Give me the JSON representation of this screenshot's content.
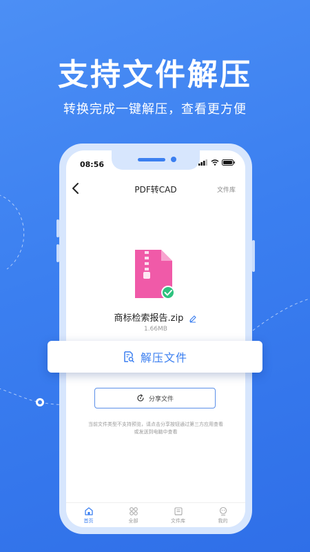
{
  "promo": {
    "headline": "支持文件解压",
    "subline": "转换完成一键解压，查看更方便"
  },
  "status_bar": {
    "time": "08:56"
  },
  "navbar": {
    "title": "PDF转CAD",
    "right_link": "文件库"
  },
  "file": {
    "name": "商标检索报告.zip",
    "size": "1.66MB"
  },
  "actions": {
    "unzip_label": "解压文件",
    "share_label": "分享文件"
  },
  "note": "当前文件类型不支持预览，请点击分享按钮通过第三方应用查看或发送到电脑中查看",
  "tabbar": [
    {
      "label": "首页",
      "icon": "home-icon",
      "active": true
    },
    {
      "label": "全部",
      "icon": "grid-icon",
      "active": false
    },
    {
      "label": "文件库",
      "icon": "folder-icon",
      "active": false
    },
    {
      "label": "我的",
      "icon": "profile-icon",
      "active": false
    }
  ],
  "colors": {
    "accent": "#3b7ff0",
    "file_pink": "#f05aa8",
    "success": "#2ec27e"
  }
}
